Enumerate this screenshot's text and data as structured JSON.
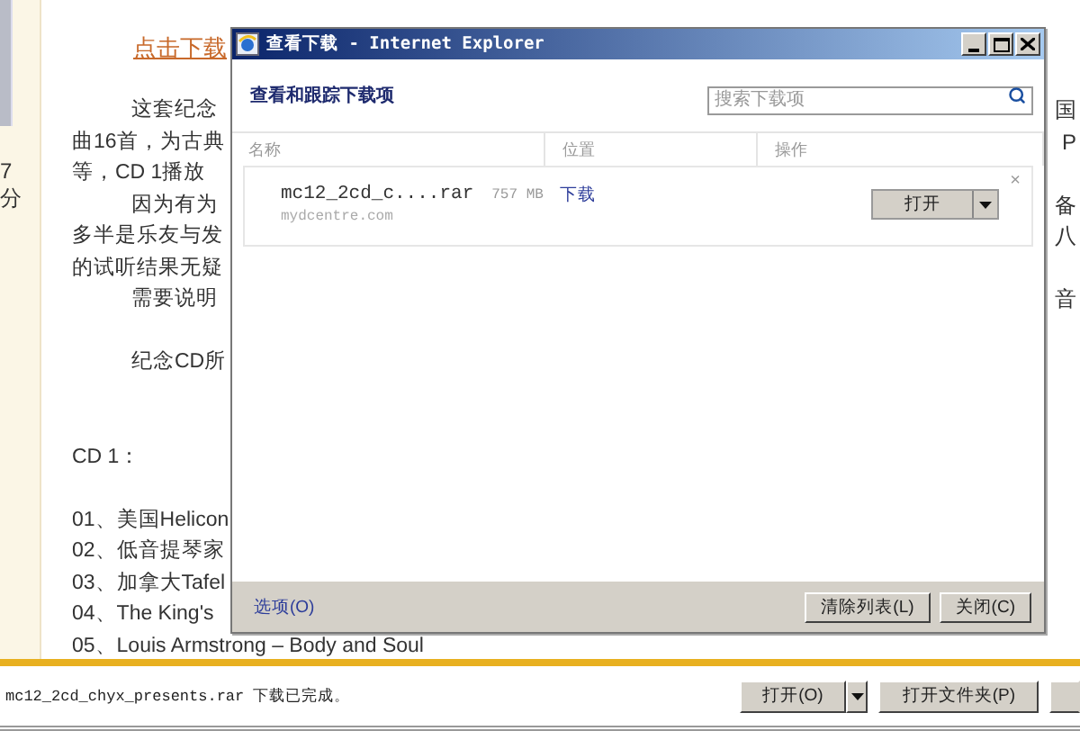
{
  "page": {
    "side_labels": [
      "7",
      "分"
    ],
    "download_link": "点击下载",
    "paragraphs": [
      {
        "kind": "text",
        "lines": [
          {
            "text": "这套纪念",
            "indent": true,
            "tail": "国"
          },
          {
            "text": "曲16首，为古典",
            "indent": false,
            "tail": "P"
          },
          {
            "text": "等，CD 1播放",
            "indent": false
          },
          {
            "text": "因为有为",
            "indent": true,
            "tail": "备"
          },
          {
            "text": "多半是乐友与发",
            "indent": false,
            "tail": "八"
          },
          {
            "text": "的试听结果无疑",
            "indent": false
          },
          {
            "text": "需要说明",
            "indent": true,
            "tail": "音"
          }
        ]
      },
      {
        "kind": "text",
        "lines": [
          {
            "text": "纪念CD所",
            "indent": true
          }
        ]
      },
      {
        "kind": "heading",
        "lines": [
          {
            "text": "CD 1：",
            "indent": false
          }
        ]
      },
      {
        "kind": "text",
        "lines": [
          {
            "text": "01、美国Helicon",
            "indent": false
          },
          {
            "text": "02、低音提琴家",
            "indent": false
          },
          {
            "text": "03、加拿大Tafel",
            "indent": false
          },
          {
            "text": "04、The King's",
            "indent": false
          },
          {
            "text": "05、Louis Armstrong – Body and Soul",
            "indent": false
          }
        ]
      }
    ]
  },
  "dialog": {
    "title": "查看下载 - Internet Explorer",
    "heading": "查看和跟踪下载项",
    "search": {
      "placeholder": "搜索下载项"
    },
    "columns": [
      "名称",
      "位置",
      "操作"
    ],
    "items": [
      {
        "name": "mc12_2cd_c....rar",
        "size": "757 MB",
        "source": "mydcentre.com",
        "location": "下载",
        "action": "打开",
        "remove": "×"
      }
    ],
    "options_link": "选项(O)",
    "buttons": [
      "清除列表(L)",
      "关闭(C)"
    ]
  },
  "notification": {
    "message": "mc12_2cd_chyx_presents.rar 下载已完成。",
    "buttons": [
      {
        "kind": "split",
        "label": "打开(O)"
      },
      {
        "kind": "plain",
        "label": "打开文件夹(P)"
      },
      {
        "kind": "cut"
      }
    ]
  }
}
